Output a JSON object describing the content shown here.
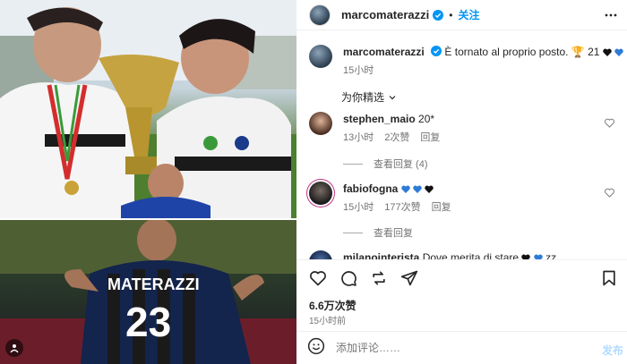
{
  "post": {
    "username": "marcomaterazzi",
    "follow_label": "关注",
    "dot": "•",
    "caption_text": "È tornato al proprio posto. 🏆 21",
    "caption_time": "15小时",
    "picks_label": "为你精选"
  },
  "comments": [
    {
      "username": "stephen_maio",
      "text": "20*",
      "time": "13小时",
      "likes": "2次赞",
      "reply": "回复",
      "view_replies": "查看回复 (4)"
    },
    {
      "username": "fabiofogna",
      "text": "",
      "time": "15小时",
      "likes": "177次赞",
      "reply": "回复",
      "view_replies": "查看回复"
    },
    {
      "username": "milanointerista",
      "text": "Dove merita di stare",
      "suffix": "zz"
    }
  ],
  "actions": {
    "likes_count": "6.6万次赞",
    "post_time": "15小时前"
  },
  "comment_box": {
    "placeholder": "添加评论……",
    "post_label": "发布"
  },
  "icons": [
    "ellipsis-icon",
    "heart-icon",
    "comment-icon",
    "repost-icon",
    "share-icon",
    "bookmark-icon",
    "emoji-icon",
    "verified-badge-icon",
    "chevron-down-icon",
    "media-collection-icon"
  ],
  "colors": {
    "accent": "#0095f6",
    "muted": "#737373",
    "text": "#262626",
    "verified": "#0095f6",
    "heart_blue": "#2e7bd6"
  }
}
